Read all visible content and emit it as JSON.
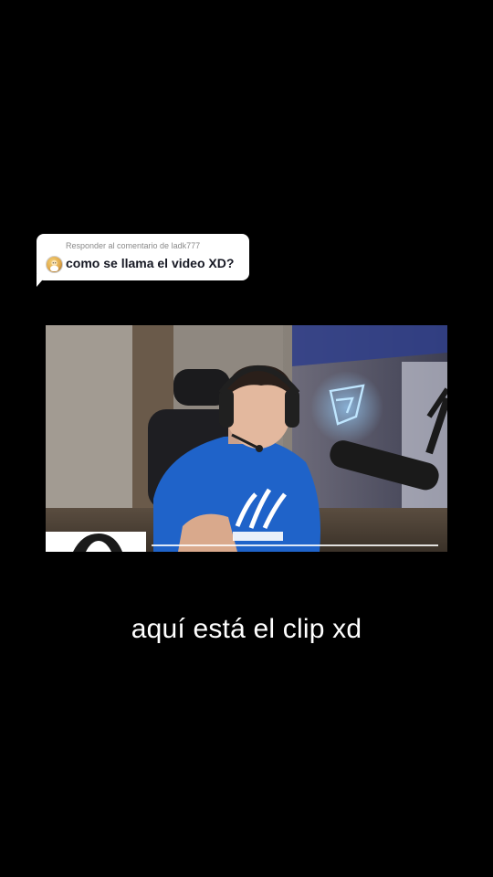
{
  "reply": {
    "header": "Responder al comentario de ladk777",
    "comment": "como se llama el video XD?",
    "avatar_icon": "user-avatar"
  },
  "video": {
    "description": "",
    "progress": 0.0
  },
  "caption": "aquí está el clip xd",
  "colors": {
    "background": "#000000",
    "bubble": "#ffffff",
    "hoodie": "#1f63c9",
    "neon": "#7fc4ff"
  }
}
